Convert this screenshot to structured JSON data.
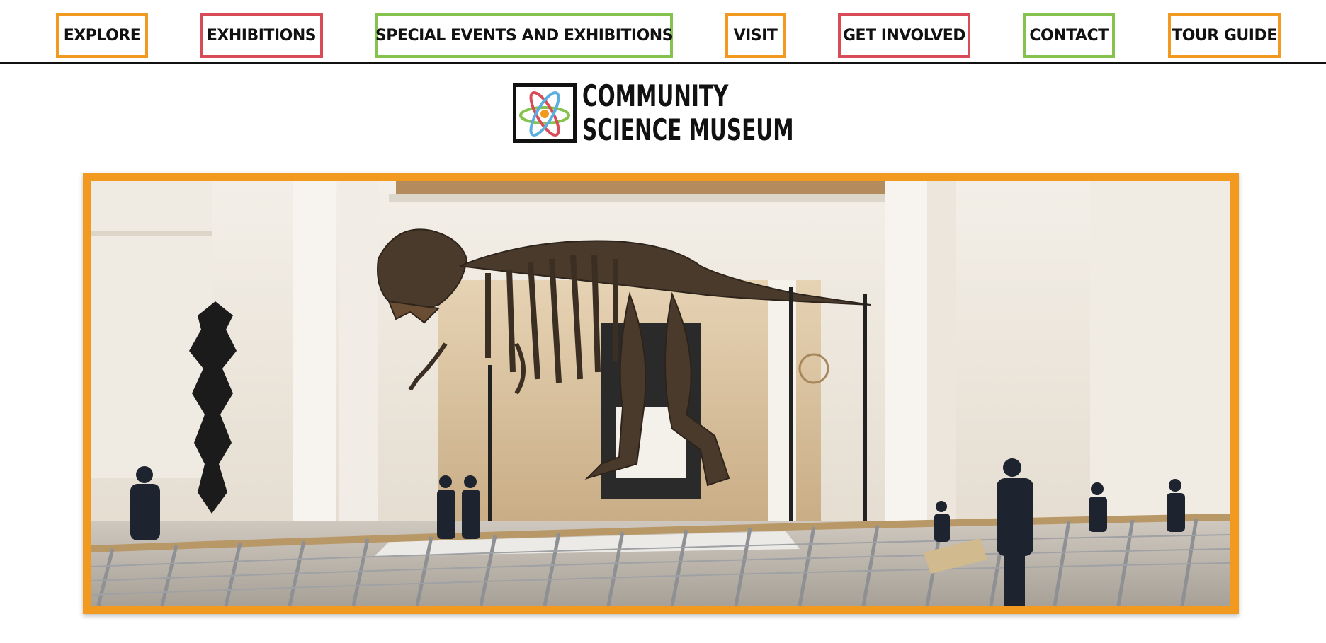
{
  "nav": {
    "items": [
      {
        "label": "EXPLORE",
        "color": "#f29a1f"
      },
      {
        "label": "EXHIBITIONS",
        "color": "#d94c57"
      },
      {
        "label": "SPECIAL EVENTS AND EXHIBITIONS",
        "color": "#86c34e"
      },
      {
        "label": "VISIT",
        "color": "#f29a1f"
      },
      {
        "label": "GET INVOLVED",
        "color": "#d94c57"
      },
      {
        "label": "CONTACT",
        "color": "#86c34e"
      },
      {
        "label": "TOUR GUIDE",
        "color": "#f29a1f"
      }
    ]
  },
  "logo": {
    "line1": "COMMUNITY",
    "line2": "SCIENCE MUSEUM",
    "icon": "atom-icon"
  },
  "hero": {
    "image": "museum-hall-dinosaur-skeleton-photo",
    "frame_color": "#f29a1f"
  },
  "colors": {
    "orange": "#f29a1f",
    "red": "#d94c57",
    "green": "#86c34e",
    "blue": "#5aaee0"
  }
}
